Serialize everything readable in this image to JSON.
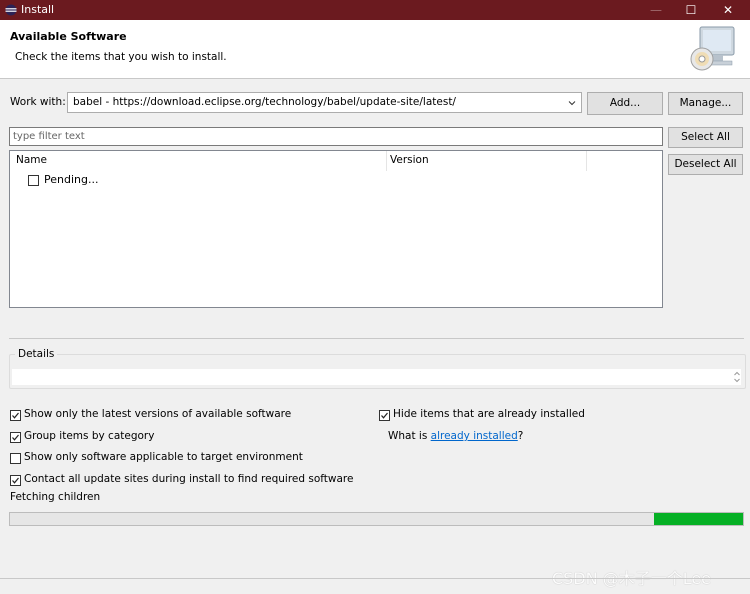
{
  "window": {
    "title": "Install",
    "minimize_glyph": "—",
    "maximize_glyph": "☐",
    "close_glyph": "✕"
  },
  "header": {
    "title": "Available Software",
    "description": "Check the items that you wish to install."
  },
  "work_with": {
    "label": "Work with:",
    "value": "babel - https://download.eclipse.org/technology/babel/update-site/latest/",
    "add_label": "Add...",
    "manage_label": "Manage..."
  },
  "filter": {
    "placeholder": "type filter text",
    "select_all_label": "Select All",
    "deselect_all_label": "Deselect All"
  },
  "tree": {
    "columns": [
      "Name",
      "Version"
    ],
    "items": [
      {
        "label": "Pending...",
        "checked": false
      }
    ]
  },
  "details": {
    "label": "Details"
  },
  "options": {
    "show_latest": {
      "label": "Show only the latest versions of available software",
      "checked": true
    },
    "hide_installed": {
      "label": "Hide items that are already installed",
      "checked": true
    },
    "group_by_category": {
      "label": "Group items by category",
      "checked": true
    },
    "what_is_prefix": "What is ",
    "what_is_link": "already installed",
    "what_is_suffix": "?",
    "show_applicable": {
      "label": "Show only software applicable to target environment",
      "checked": false
    },
    "contact_sites": {
      "label": "Contact all update sites during install to find required software",
      "checked": true
    }
  },
  "status": {
    "text": "Fetching children"
  },
  "watermark": "CSDN @木子一个Lee",
  "colors": {
    "titlebar": "#6b1a1f",
    "progress": "#06b025",
    "link": "#0066cc"
  }
}
